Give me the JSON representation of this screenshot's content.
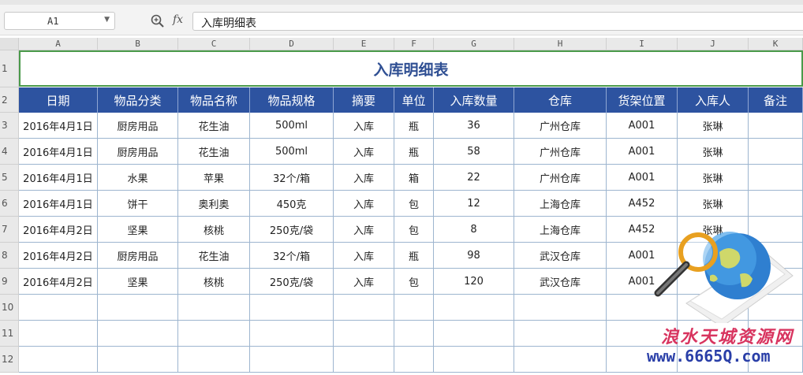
{
  "formula_bar": {
    "name_box": "A1",
    "fx_label": "fx",
    "formula": "入库明细表"
  },
  "columns": [
    "A",
    "B",
    "C",
    "D",
    "E",
    "F",
    "G",
    "H",
    "I",
    "J",
    "K"
  ],
  "rows": [
    "1",
    "2",
    "3",
    "4",
    "5",
    "6",
    "7",
    "8",
    "9",
    "10",
    "11",
    "12"
  ],
  "sheet": {
    "title": "入库明细表",
    "headers": [
      "日期",
      "物品分类",
      "物品名称",
      "物品规格",
      "摘要",
      "单位",
      "入库数量",
      "仓库",
      "货架位置",
      "入库人",
      "备注"
    ],
    "records": [
      [
        "2016年4月1日",
        "厨房用品",
        "花生油",
        "500ml",
        "入库",
        "瓶",
        "36",
        "广州仓库",
        "A001",
        "张琳",
        ""
      ],
      [
        "2016年4月1日",
        "厨房用品",
        "花生油",
        "500ml",
        "入库",
        "瓶",
        "58",
        "广州仓库",
        "A001",
        "张琳",
        ""
      ],
      [
        "2016年4月1日",
        "水果",
        "苹果",
        "32个/箱",
        "入库",
        "箱",
        "22",
        "广州仓库",
        "A001",
        "张琳",
        ""
      ],
      [
        "2016年4月1日",
        "饼干",
        "奥利奥",
        "450克",
        "入库",
        "包",
        "12",
        "上海仓库",
        "A452",
        "张琳",
        ""
      ],
      [
        "2016年4月2日",
        "坚果",
        "核桃",
        "250克/袋",
        "入库",
        "包",
        "8",
        "上海仓库",
        "A452",
        "张琳",
        ""
      ],
      [
        "2016年4月2日",
        "厨房用品",
        "花生油",
        "32个/箱",
        "入库",
        "瓶",
        "98",
        "武汉仓库",
        "A001",
        "",
        ""
      ],
      [
        "2016年4月2日",
        "坚果",
        "核桃",
        "250克/袋",
        "入库",
        "包",
        "120",
        "武汉仓库",
        "A001",
        "",
        ""
      ]
    ]
  },
  "watermark": {
    "site_name": "浪水天城资源网",
    "site_url": "www.6665Q.com"
  },
  "colors": {
    "header_bg": "#2d53a0",
    "title_text": "#2f4f93",
    "selection_border": "#4a9a4a"
  }
}
